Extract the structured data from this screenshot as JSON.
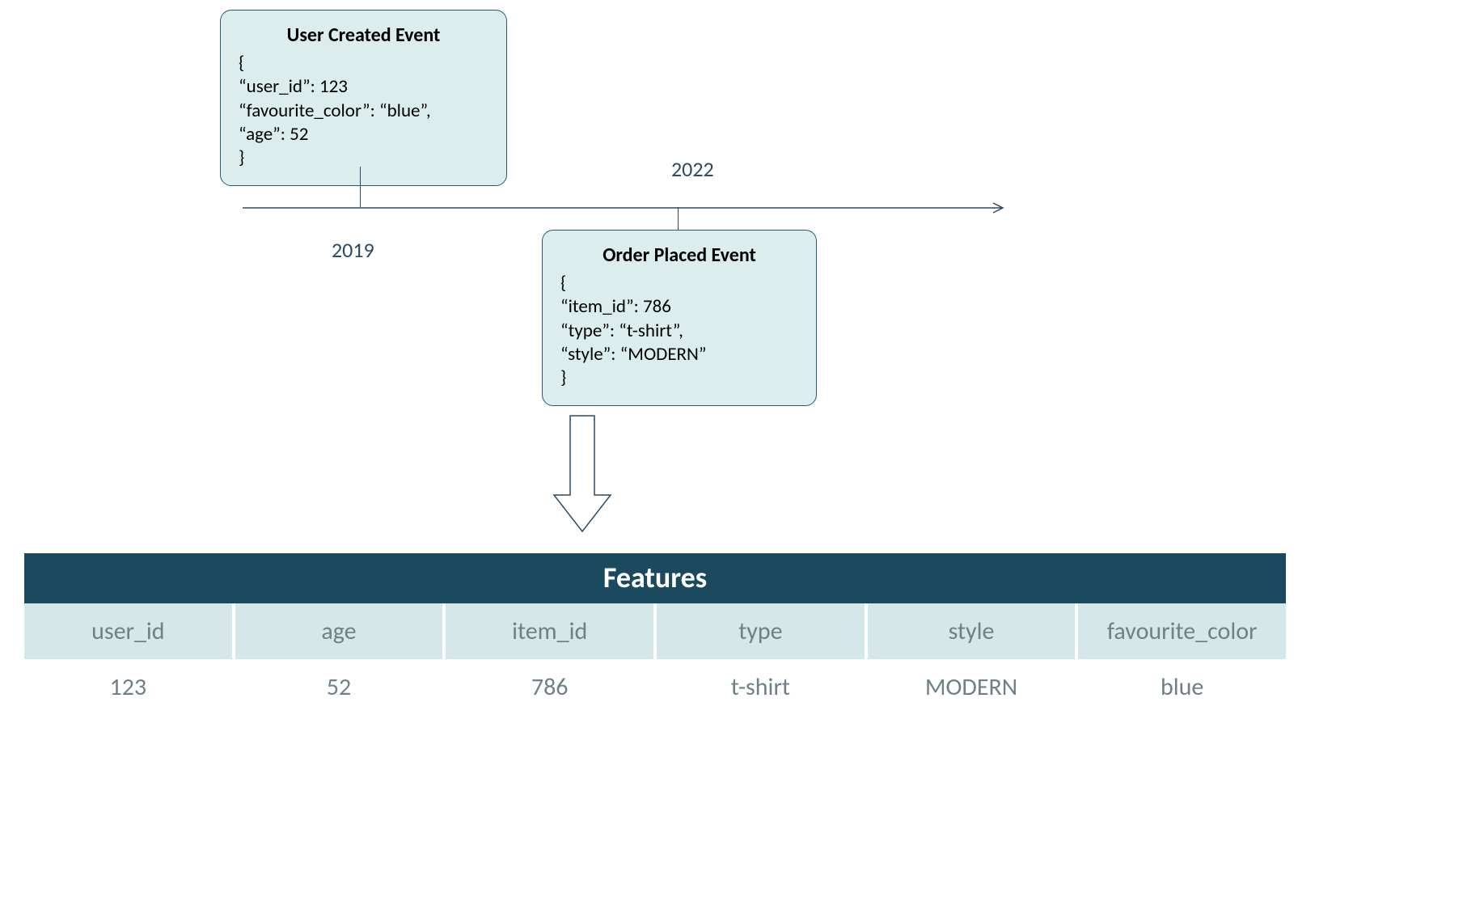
{
  "timeline": {
    "label_2019": "2019",
    "label_2022": "2022"
  },
  "event1": {
    "title": "User Created Event",
    "body": "{\n“user_id”: 123\n“favourite_color”: “blue”,\n“age”: 52\n}"
  },
  "event2": {
    "title": "Order Placed Event",
    "body": "{\n“item_id”: 786\n“type”: “t-shirt”,\n“style”: “MODERN”\n}"
  },
  "features": {
    "title": "Features",
    "columns": [
      "user_id",
      "age",
      "item_id",
      "type",
      "style",
      "favourite_color"
    ],
    "row": [
      "123",
      "52",
      "786",
      "t-shirt",
      "MODERN",
      "blue"
    ]
  }
}
